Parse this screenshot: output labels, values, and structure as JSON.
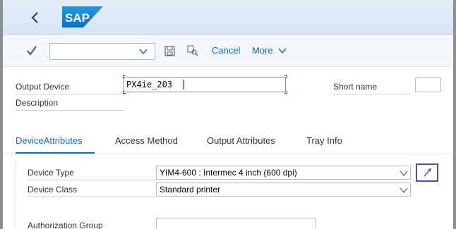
{
  "shell": {
    "back_icon": "chevron-left-icon",
    "logo_text": "SAP",
    "brand_color": "#0a6ed1"
  },
  "toolbar": {
    "ok_icon": "checkmark-icon",
    "command_field_value": "",
    "save_icon": "save-icon",
    "find_icon": "find-icon",
    "cancel_label": "Cancel",
    "more_label": "More"
  },
  "header": {
    "output_device_label": "Output Device",
    "output_device_value": "PX4ie_203",
    "short_name_label": "Short name",
    "short_name_value": "",
    "description_label": "Description"
  },
  "tabs": [
    {
      "label": "DeviceAttributes",
      "active": true
    },
    {
      "label": "Access Method",
      "active": false
    },
    {
      "label": "Output Attributes",
      "active": false
    },
    {
      "label": "Tray Info",
      "active": false
    }
  ],
  "device_attributes": {
    "device_type_label": "Device Type",
    "device_type_value": "YIM4-600 : Intermec 4 inch (600 dpi)",
    "device_class_label": "Device Class",
    "device_class_value": "Standard printer",
    "authorization_group_label": "Authorization Group",
    "authorization_group_value": ""
  }
}
